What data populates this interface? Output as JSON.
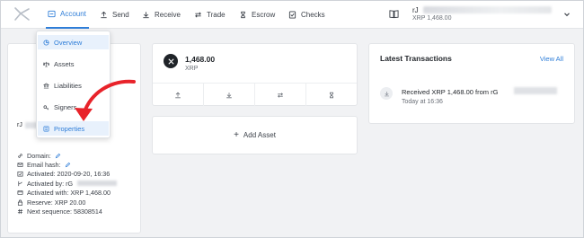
{
  "nav": {
    "items": [
      {
        "label": "Account",
        "icon": "account-card-icon"
      },
      {
        "label": "Send",
        "icon": "upload-icon"
      },
      {
        "label": "Receive",
        "icon": "download-icon"
      },
      {
        "label": "Trade",
        "icon": "swap-icon"
      },
      {
        "label": "Escrow",
        "icon": "hourglass-icon"
      },
      {
        "label": "Checks",
        "icon": "check-doc-icon"
      }
    ],
    "account_name_prefix": "rJ",
    "account_balance": "XRP 1,468.00"
  },
  "dropdown": {
    "items": [
      {
        "label": "Overview",
        "icon": "pie-icon"
      },
      {
        "label": "Assets",
        "icon": "scale-icon"
      },
      {
        "label": "Liabilities",
        "icon": "bank-icon"
      },
      {
        "label": "Signers",
        "icon": "key-icon"
      },
      {
        "label": "Properties",
        "icon": "settings-list-icon"
      }
    ]
  },
  "account_card": {
    "address_prefix": "rJ",
    "domain_label": "Domain:",
    "email_label": "Email hash:",
    "activated": "Activated: 2020-09-20, 16:36",
    "activated_by_label": "Activated by: rG",
    "activated_with": "Activated with: XRP 1,468.00",
    "reserve": "Reserve: XRP 20.00",
    "next_sequence": "Next sequence: 58308514"
  },
  "balance_card": {
    "amount": "1,468.00",
    "code": "XRP"
  },
  "add_asset": {
    "label": "Add Asset"
  },
  "transactions": {
    "title": "Latest Transactions",
    "view_all": "View All",
    "item": {
      "description": "Received XRP 1,468.00 from rG",
      "time": "Today at 16:36"
    }
  },
  "colors": {
    "accent": "#2f7ed8",
    "annotation_arrow": "#e8232a",
    "background": "#f1f2f4"
  }
}
